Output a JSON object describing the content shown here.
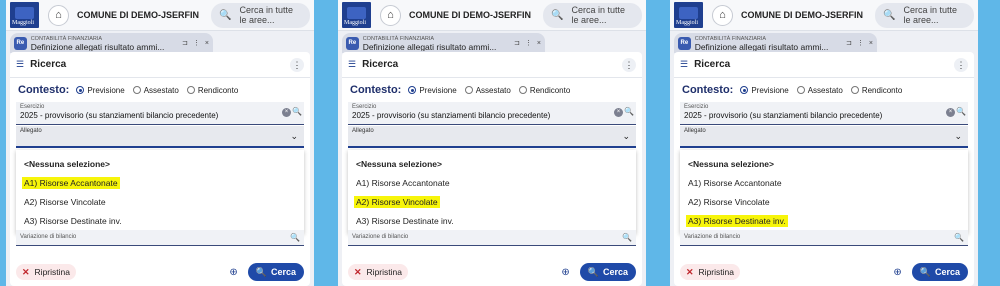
{
  "app": {
    "municipality": "COMUNE DI DEMO-JSERFIN",
    "logo_text": "Maggioli",
    "search_placeholder": "Cerca in tutte le aree..."
  },
  "tab": {
    "icon_text": "Re",
    "section": "CONTABILITÀ FINANZIARIA",
    "title": "Definizione allegati risultato ammi...",
    "actions": [
      "⊐",
      "⋮",
      "×"
    ]
  },
  "search_card": {
    "title": "Ricerca",
    "contesto_label": "Contesto:",
    "radios": [
      "Previsione",
      "Assestato",
      "Rendiconto"
    ],
    "selected_radio": "Previsione",
    "esercizio_label": "Esercizio",
    "esercizio_value": "2025 - provvisorio (su stanziamenti bilancio precedente)",
    "allegato_label": "Allegato",
    "options": [
      "<Nessuna selezione>",
      "A1) Risorse Accantonate",
      "A2) Risorse Vincolate",
      "A3) Risorse Destinate inv."
    ],
    "variazione_label": "Variazione di bilancio",
    "reset_label": "Ripristina",
    "search_label": "Cerca"
  },
  "panels": [
    {
      "highlighted_option": 1
    },
    {
      "highlighted_option": 2
    },
    {
      "highlighted_option": 3
    }
  ],
  "colors": {
    "background": "#5fb7e8",
    "accent": "#1f4aa8",
    "highlight": "#f7f50a"
  }
}
